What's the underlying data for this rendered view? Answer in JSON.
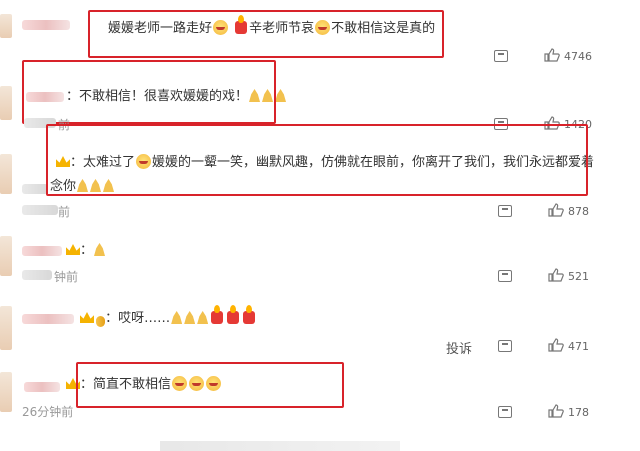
{
  "comments": [
    {
      "text": "媛媛老师一路走好",
      "text2": "辛老师节哀",
      "text3": "不敢相信这是真的",
      "likes": "4746"
    },
    {
      "text": "不敢相信！很喜欢媛媛的戏！",
      "time": "前",
      "likes": "1420"
    },
    {
      "text": "太难过了",
      "text2": "媛媛的一颦一笑，幽默风趣，仿佛就在眼前，你离开了我们，我们永远都爱着",
      "text3": "念你",
      "time": "前",
      "likes": "878"
    },
    {
      "time": "钟前",
      "likes": "521"
    },
    {
      "text": "哎呀……",
      "report_label": "投诉",
      "likes": "471"
    },
    {
      "text": "简直不敢相信",
      "time": "26分钟前",
      "likes": "178"
    }
  ],
  "icons": {
    "share": "share-icon",
    "like": "thumbs-up-icon",
    "cry_emoji": "crying-face-emoji",
    "candle": "candle-emoji",
    "pray": "praying-hands-emoji",
    "crown": "crown-badge-icon"
  },
  "colors": {
    "highlight_box": "#d8232a",
    "secondary_text": "#999999",
    "badge_gold": "#f5b301"
  }
}
